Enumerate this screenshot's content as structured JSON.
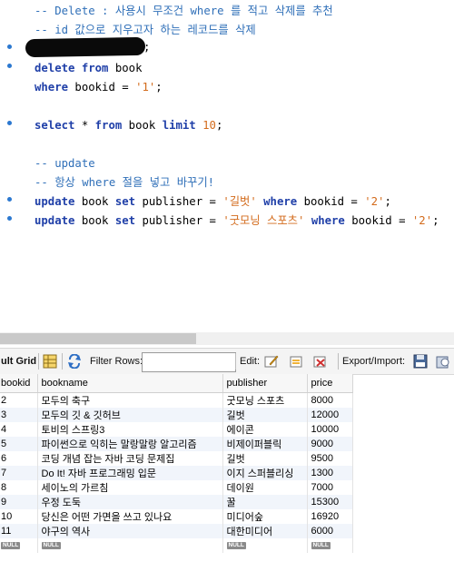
{
  "editor": {
    "lines": [
      [
        {
          "t": "-- Delete : 사용시 무조건 where 를 적고 삭제를 추천",
          "c": "cm"
        }
      ],
      [
        {
          "t": "-- id 값으로 지우고자 하는 레코드를 삭제",
          "c": "cm"
        }
      ],
      [],
      [
        {
          "t": "delete",
          "c": "kw"
        },
        {
          "t": " "
        },
        {
          "t": "from",
          "c": "kw"
        },
        {
          "t": " book"
        }
      ],
      [
        {
          "t": "where",
          "c": "kw"
        },
        {
          "t": " bookid = "
        },
        {
          "t": "'1'",
          "c": "str"
        },
        {
          "t": ";"
        }
      ],
      [],
      [
        {
          "t": "select",
          "c": "kw"
        },
        {
          "t": " * "
        },
        {
          "t": "from",
          "c": "kw"
        },
        {
          "t": " book "
        },
        {
          "t": "limit",
          "c": "kw"
        },
        {
          "t": " "
        },
        {
          "t": "10",
          "c": "num"
        },
        {
          "t": ";"
        }
      ],
      [],
      [
        {
          "t": "-- update",
          "c": "cm"
        }
      ],
      [
        {
          "t": "-- 항상 where 절을 넣고 바꾸기!",
          "c": "cm"
        }
      ],
      [
        {
          "t": "update",
          "c": "kw"
        },
        {
          "t": " book "
        },
        {
          "t": "set",
          "c": "kw"
        },
        {
          "t": " publisher = "
        },
        {
          "t": "'길벗'",
          "c": "str"
        },
        {
          "t": " "
        },
        {
          "t": "where",
          "c": "kw"
        },
        {
          "t": " bookid = "
        },
        {
          "t": "'2'",
          "c": "str"
        },
        {
          "t": ";"
        }
      ],
      [
        {
          "t": "update",
          "c": "kw"
        },
        {
          "t": " book "
        },
        {
          "t": "set",
          "c": "kw"
        },
        {
          "t": " publisher = "
        },
        {
          "t": "'굿모닝 스포츠'",
          "c": "str"
        },
        {
          "t": " "
        },
        {
          "t": "where",
          "c": "kw"
        },
        {
          "t": " bookid = "
        },
        {
          "t": "'2'",
          "c": "str"
        },
        {
          "t": ";"
        }
      ]
    ],
    "redacted_line_suffix": ";"
  },
  "toolbar": {
    "result_grid_label": "ult Grid",
    "filter_rows_label": "Filter Rows:",
    "filter_value": "",
    "edit_label": "Edit:",
    "export_label": "Export/Import:"
  },
  "grid": {
    "columns": [
      "bookid",
      "bookname",
      "publisher",
      "price"
    ],
    "rows": [
      [
        "2",
        "모두의 축구",
        "굿모닝 스포츠",
        "8000"
      ],
      [
        "3",
        "모두의 깃 & 깃허브",
        "길벗",
        "12000"
      ],
      [
        "4",
        "토비의 스프링3",
        "에이콘",
        "10000"
      ],
      [
        "5",
        "파이썬으로 익히는 말랑말랑 알고리즘",
        "비제이퍼블릭",
        "9000"
      ],
      [
        "6",
        "코딩 개념 잡는 자바 코딩 문제집",
        "길벗",
        "9500"
      ],
      [
        "7",
        "Do It! 자바 프로그래밍 입문",
        "이지 스퍼블리싱",
        "1300"
      ],
      [
        "8",
        "세이노의 가르침",
        "데이원",
        "7000"
      ],
      [
        "9",
        "우정 도둑",
        "꿀",
        "15300"
      ],
      [
        "10",
        "당신은 어떤 가면을 쓰고 있나요",
        "미디어숲",
        "16920"
      ],
      [
        "11",
        "야구의 역사",
        "대한미디어",
        "6000"
      ]
    ],
    "null_label": "NULL"
  }
}
